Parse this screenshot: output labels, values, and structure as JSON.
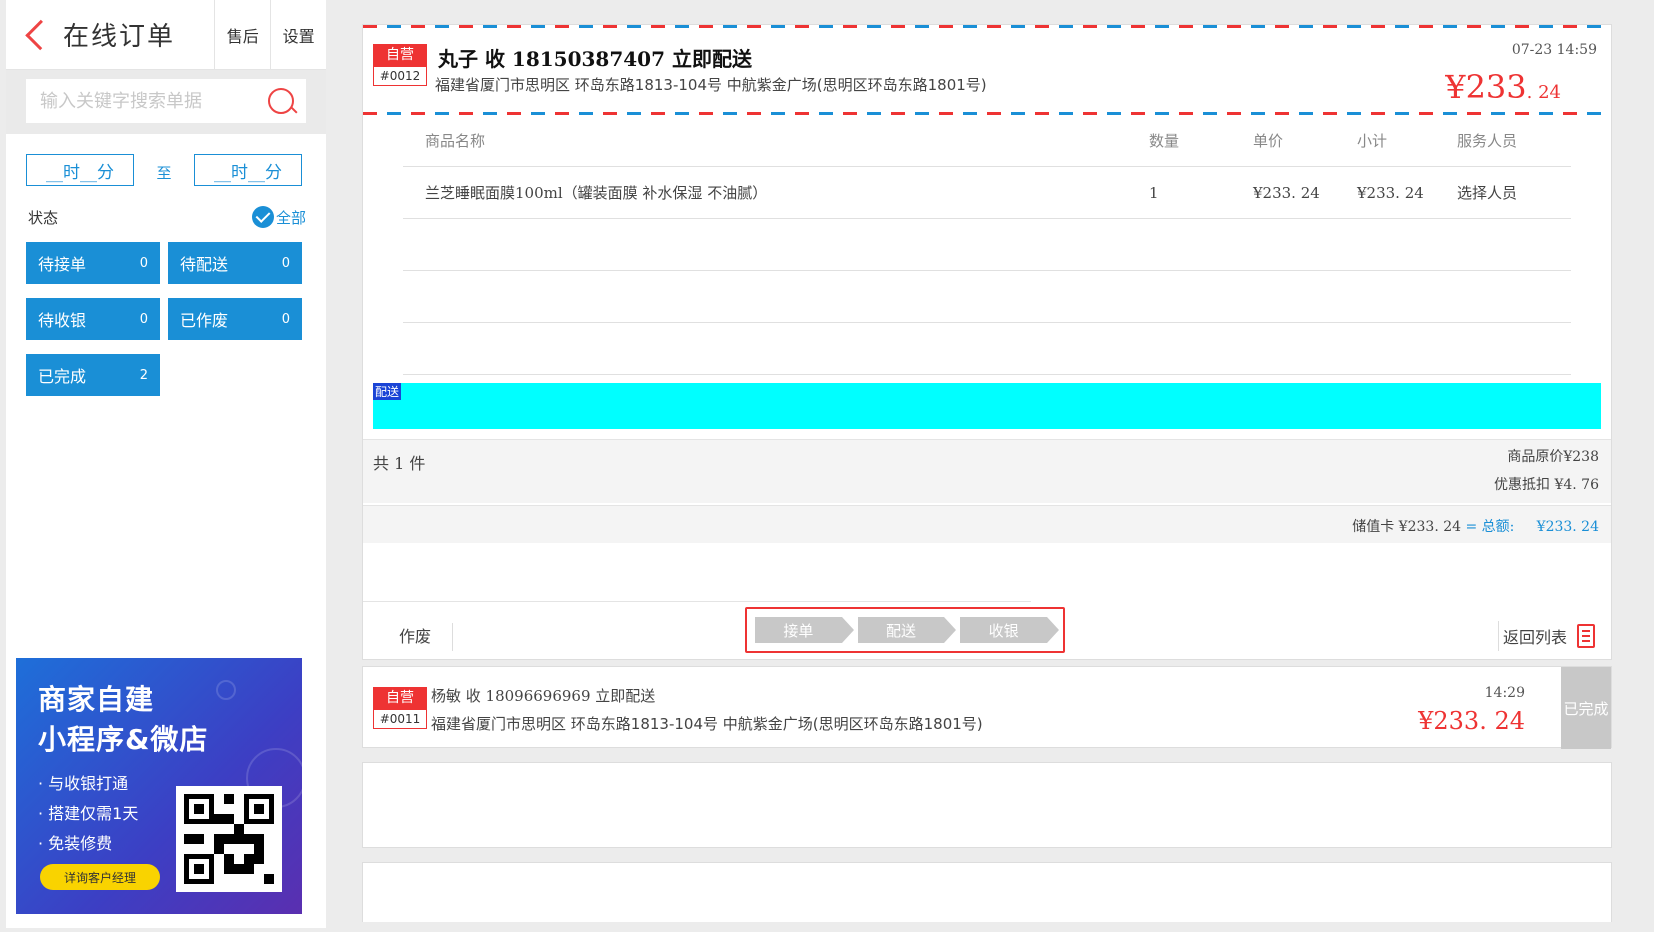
{
  "left": {
    "title": "在线订单",
    "aftersale": "售后",
    "settings": "设置",
    "search_placeholder": "输入关键字搜索单据",
    "time_from": "__时__分",
    "time_to": "__时__分",
    "to_label": "至",
    "status_label": "状态",
    "all_label": "全部",
    "statuses": [
      {
        "label": "待接单",
        "count": "0"
      },
      {
        "label": "待配送",
        "count": "0"
      },
      {
        "label": "待收银",
        "count": "0"
      },
      {
        "label": "已作废",
        "count": "0"
      },
      {
        "label": "已完成",
        "count": "2"
      }
    ]
  },
  "ad": {
    "line1": "商家自建",
    "line2": "小程序&微店",
    "points": [
      "· 与收银打通",
      "· 搭建仅需1天",
      "· 免装修费"
    ],
    "consult": "详询客户经理"
  },
  "order1": {
    "badge_top": "自营",
    "badge_no": "#0012",
    "headline": "丸子 收 18150387407 立即配送",
    "address": "福建省厦门市思明区 环岛东路1813-104号 中航紫金广场(思明区环岛东路1801号)",
    "time": "07-23 14:59",
    "amount_int": "¥233",
    "amount_dec": ". 24",
    "columns": [
      "商品名称",
      "数量",
      "单价",
      "小计",
      "服务人员"
    ],
    "items": [
      {
        "name": "兰芝睡眠面膜100ml（罐装面膜 补水保湿 不油腻）",
        "qty": "1",
        "price": "¥233. 24",
        "subtotal": "¥233. 24",
        "staff": "选择人员"
      }
    ],
    "delivery_label": "配送",
    "count_text": "共 1 件",
    "original_price": "商品原价¥238",
    "discount": "优惠抵扣 ¥4. 76",
    "pay_method": "储值卡 ¥233. 24",
    "eq": "=",
    "total_label": "总额:",
    "total_value": "¥233. 24",
    "void": "作废",
    "steps": [
      "接单",
      "配送",
      "收银"
    ],
    "back": "返回列表"
  },
  "order2": {
    "badge_top": "自营",
    "badge_no": "#0011",
    "headline": "杨敏 收 18096696969 立即配送",
    "address": "福建省厦门市思明区 环岛东路1813-104号 中航紫金广场(思明区环岛东路1801号)",
    "time": "14:29",
    "amount": "¥233. 24",
    "status": "已完成"
  },
  "colors": {
    "accent_blue": "#1a8fd6",
    "accent_red": "#e33",
    "delivery_bar": "#00ffff"
  }
}
